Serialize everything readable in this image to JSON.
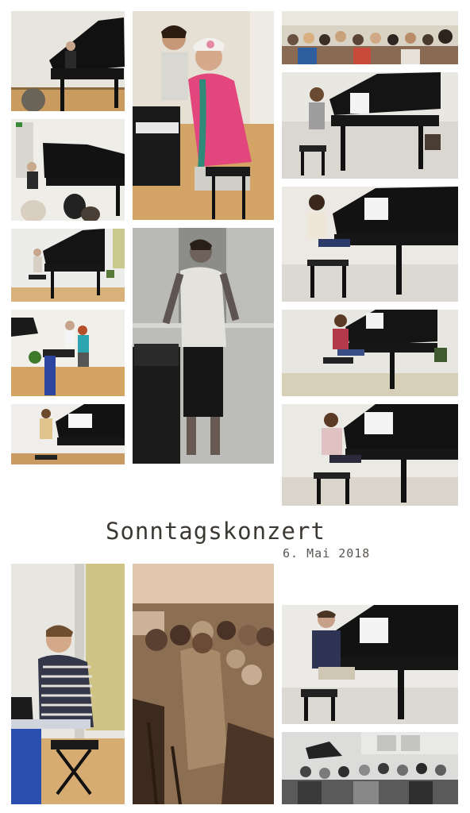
{
  "title": "Sonntagskonzert",
  "date": "6. Mai 2018"
}
